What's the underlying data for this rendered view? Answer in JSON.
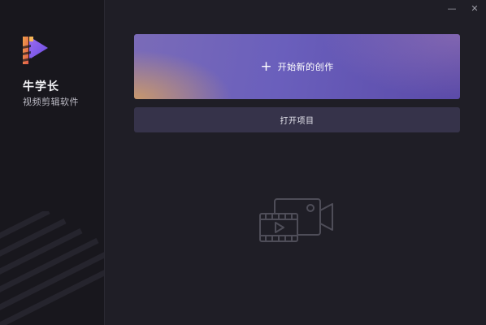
{
  "sidebar": {
    "brand_name": "牛学长",
    "brand_subtitle": "视频剪辑软件",
    "logo_icon": "brand-logo-icon"
  },
  "window_controls": {
    "minimize": "—",
    "close": "✕"
  },
  "main": {
    "new_project": {
      "icon": "plus-icon",
      "plus_glyph": "+",
      "label": "开始新的创作"
    },
    "open_project": {
      "label": "打开项目"
    },
    "empty_state_icon": "video-camera-film-icon"
  },
  "colors": {
    "background": "#1f1e26",
    "sidebar": "#18171d",
    "accent_purple": "#6a5fbc",
    "accent_orange": "#d6a05f",
    "open_button": "#36334a"
  }
}
